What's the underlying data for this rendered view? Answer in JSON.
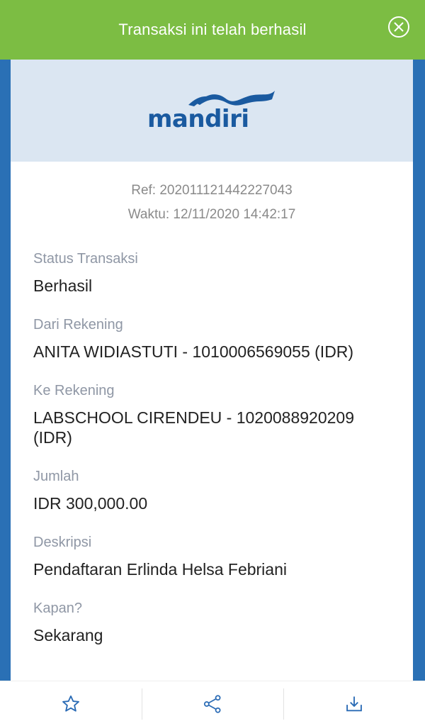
{
  "banner": {
    "message": "Transaksi ini telah berhasil",
    "close_icon": "close-circle-icon"
  },
  "brand": {
    "logo_text": "mandiri",
    "logo_color": "#1a5aa0"
  },
  "transaction": {
    "ref": "Ref: 202011121442227043",
    "time": "Waktu: 12/11/2020 14:42:17"
  },
  "fields": [
    {
      "label": "Status Transaksi",
      "value": "Berhasil"
    },
    {
      "label": "Dari Rekening",
      "value": "ANITA WIDIASTUTI - 1010006569055 (IDR)"
    },
    {
      "label": "Ke Rekening",
      "value": "LABSCHOOL CIRENDEU - 1020088920209 (IDR)"
    },
    {
      "label": "Jumlah",
      "value": "IDR 300,000.00"
    },
    {
      "label": "Deskripsi",
      "value": "Pendaftaran Erlinda Helsa Febriani"
    },
    {
      "label": "Kapan?",
      "value": "Sekarang"
    }
  ],
  "actions": [
    {
      "icon": "star-icon"
    },
    {
      "icon": "share-icon"
    },
    {
      "icon": "download-icon"
    }
  ],
  "colors": {
    "banner_bg": "#7cbd43",
    "page_bg": "#2a70b5",
    "header_bg": "#dbe6f2",
    "icon_blue": "#2a6bb5"
  }
}
